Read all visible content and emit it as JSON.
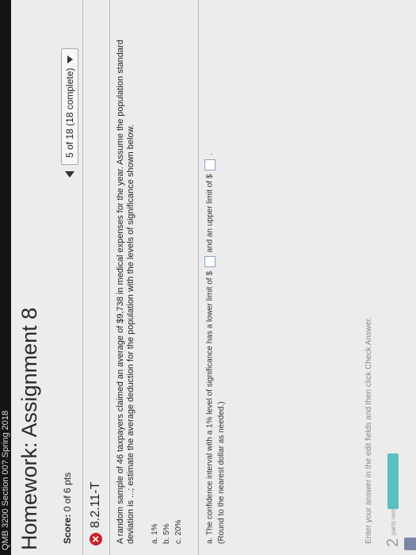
{
  "top_banner": "QMB 3200 Section 00? Spring 2018",
  "page_title": "Homework: Assignment 8",
  "score": {
    "label": "Score:",
    "value": "0 of 6 pts"
  },
  "pager": {
    "text": "5 of 18 (18 complete)"
  },
  "question": {
    "id": "8.2.11-T",
    "prompt": "A random sample of 46 taxpayers claimed an average of $9,738 in medical expenses for the year. Assume the population standard deviation is ...; estimate the average deduction for the population with the levels of significance shown below.",
    "levels": [
      "a. 1%",
      "b. 5%",
      "c. 20%"
    ],
    "part_a": {
      "text_before": "a. The confidence interval with a 1% level of significance has a lower limit of $",
      "text_middle": "and an upper limit of $",
      "text_after": ".",
      "hint": "(Round to the nearest dollar as needed.)"
    }
  },
  "footer": {
    "instructions": "Enter your answer in the edit fields and then click Check Answer.",
    "parts_count": "2",
    "parts_label": "parts remaining"
  },
  "colors": {
    "error": "#c8202a",
    "progress": "#5bbfbf"
  }
}
